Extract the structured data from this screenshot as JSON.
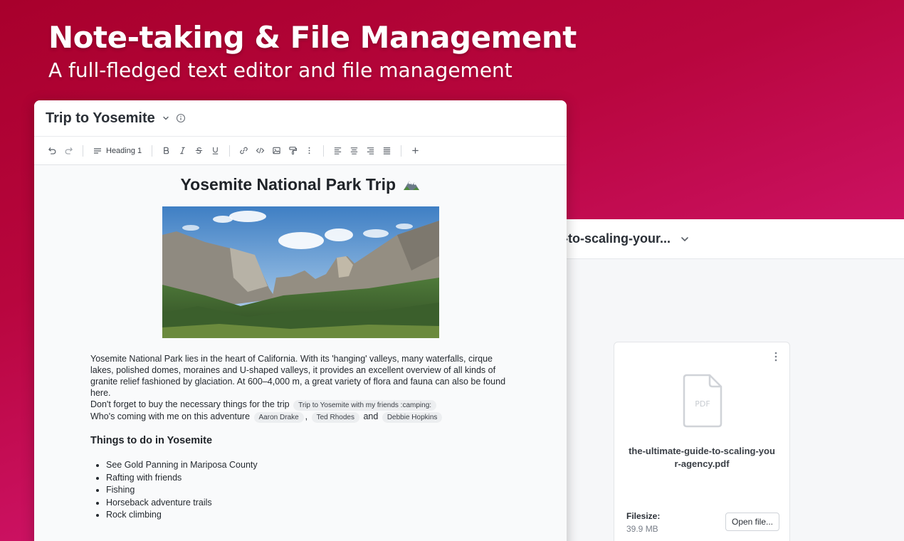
{
  "hero": {
    "title": "Note-taking & File Management",
    "subtitle": "A full-fledged text editor and file management"
  },
  "colors": {
    "gradient_top": "#a8002c",
    "gradient_bottom": "#ec2aa6"
  },
  "file_window": {
    "title": "e-to-scaling-your...",
    "file_name": "the-ultimate-guide-to-scaling-your-agency.pdf",
    "file_type": "PDF",
    "size_label": "Filesize:",
    "size_value": "39.9 MB",
    "open_button": "Open file..."
  },
  "editor": {
    "title": "Trip to Yosemite",
    "toolbar": {
      "heading_select": "Heading 1",
      "icons": [
        "undo-icon",
        "redo-icon",
        "bold-icon",
        "italic-icon",
        "strikethrough-icon",
        "underline-icon",
        "link-icon",
        "code-icon",
        "image-icon",
        "paint-roller-icon",
        "more-vertical-icon",
        "align-left-icon",
        "align-center-icon",
        "align-right-icon",
        "align-justify-icon",
        "plus-icon"
      ]
    },
    "doc": {
      "heading": "Yosemite National Park Trip",
      "paragraph": "Yosemite National Park lies in the heart of California. With its 'hanging' valleys, many waterfalls, cirque lakes, polished domes, moraines and U-shaped valleys, it provides an excellent overview of all kinds of granite relief fashioned by glaciation. At 600–4,000 m, a great variety of flora and fauna can also be found here.",
      "buy_text": "Don't forget to buy the necessary things for the trip",
      "buy_mention": "Trip to Yosemite with my friends :camping:",
      "coming_text": "Who's coming with me on this adventure",
      "people": [
        "Aaron Drake",
        "Ted Rhodes",
        "Debbie Hopkins"
      ],
      "comma": ",",
      "and_text": "and",
      "subheading": "Things to do in Yosemite",
      "todo": [
        "See Gold Panning in Mariposa County",
        "Rafting with friends",
        "Fishing",
        "Horseback adventure trails",
        "Rock climbing"
      ]
    }
  }
}
